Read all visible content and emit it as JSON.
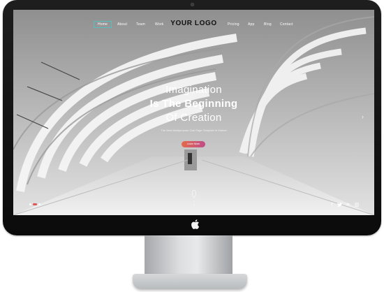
{
  "nav": {
    "items_left": [
      "Home",
      "About",
      "Team",
      "Work"
    ],
    "items_right": [
      "Pricing",
      "App",
      "Blog",
      "Contact"
    ],
    "active": "Home",
    "logo": "YOUR LOGO"
  },
  "hero": {
    "line1": "Imagination",
    "line2": "Is The Beginning",
    "line3": "Of Creation",
    "subtitle": "The Best Multipurpose One Page Template In Market",
    "cta_label": "Learn More"
  },
  "slider": {
    "dots": 3,
    "active_index": 1
  },
  "social_icons": [
    "facebook-icon",
    "twitter-icon",
    "linkedin-icon",
    "instagram-icon"
  ],
  "colors": {
    "accent": "#58bfbf",
    "cta_start": "#e36b4a",
    "cta_end": "#c04c8a"
  }
}
